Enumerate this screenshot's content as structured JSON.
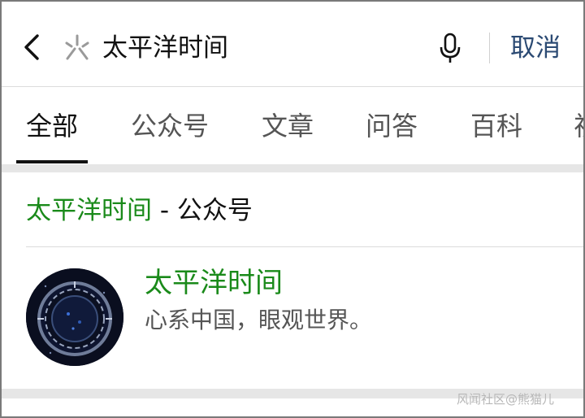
{
  "search": {
    "query": "太平洋时间",
    "cancel_label": "取消"
  },
  "tabs": [
    {
      "label": "全部",
      "active": true
    },
    {
      "label": "公众号",
      "active": false
    },
    {
      "label": "文章",
      "active": false
    },
    {
      "label": "问答",
      "active": false
    },
    {
      "label": "百科",
      "active": false
    },
    {
      "label": "视",
      "active": false
    }
  ],
  "section": {
    "keyword": "太平洋时间",
    "suffix": " - 公众号"
  },
  "result": {
    "name": "太平洋时间",
    "description": "心系中国，眼观世界。"
  },
  "watermark": "风闻社区@熊猫儿",
  "colors": {
    "keyword_green": "#1a8a1a",
    "cancel_blue": "#2b4a73"
  },
  "icons": [
    "back-icon",
    "mini-program-icon",
    "microphone-icon"
  ]
}
